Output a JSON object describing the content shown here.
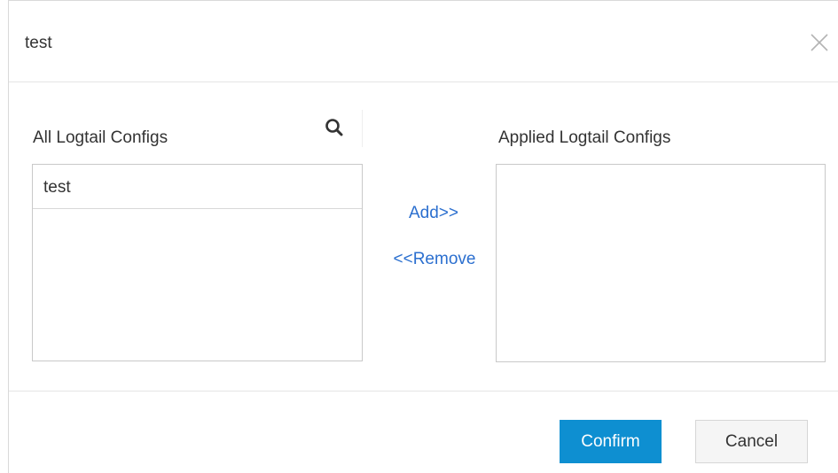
{
  "dialog": {
    "title": "test"
  },
  "left_panel": {
    "label": "All Logtail Configs",
    "items": [
      {
        "label": "test"
      }
    ]
  },
  "right_panel": {
    "label": "Applied Logtail Configs",
    "items": []
  },
  "operations": {
    "add_label": "Add>>",
    "remove_label": "<<Remove"
  },
  "footer": {
    "confirm_label": "Confirm",
    "cancel_label": "Cancel"
  },
  "icons": {
    "close": "close-icon",
    "search": "search-icon"
  },
  "colors": {
    "link": "#2b6fcf",
    "primary": "#0e8fd1",
    "border": "#c9c9c9"
  }
}
